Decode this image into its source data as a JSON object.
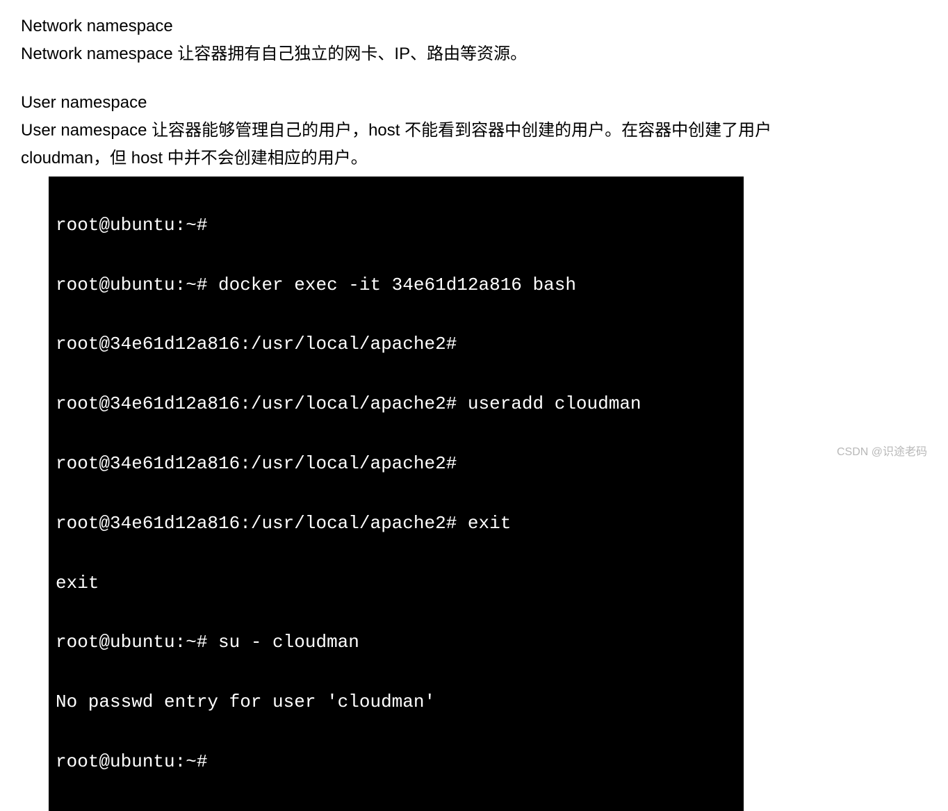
{
  "section1": {
    "heading": "Network namespace",
    "body": "Network namespace 让容器拥有自己独立的网卡、IP、路由等资源。"
  },
  "section2": {
    "heading": "User namespace",
    "body_line1": "User namespace 让容器能够管理自己的用户，host 不能看到容器中创建的用户。在容器中创建了用户",
    "body_line2": "cloudman，但 host 中并不会创建相应的用户。"
  },
  "terminal": {
    "lines": [
      "root@ubuntu:~#",
      "root@ubuntu:~# docker exec -it 34e61d12a816 bash",
      "root@34e61d12a816:/usr/local/apache2#",
      "root@34e61d12a816:/usr/local/apache2# useradd cloudman",
      "root@34e61d12a816:/usr/local/apache2#",
      "root@34e61d12a816:/usr/local/apache2# exit",
      "exit",
      "root@ubuntu:~# su - cloudman",
      "No passwd entry for user 'cloudman'",
      "root@ubuntu:~#"
    ]
  },
  "watermark": "CSDN @识途老码"
}
